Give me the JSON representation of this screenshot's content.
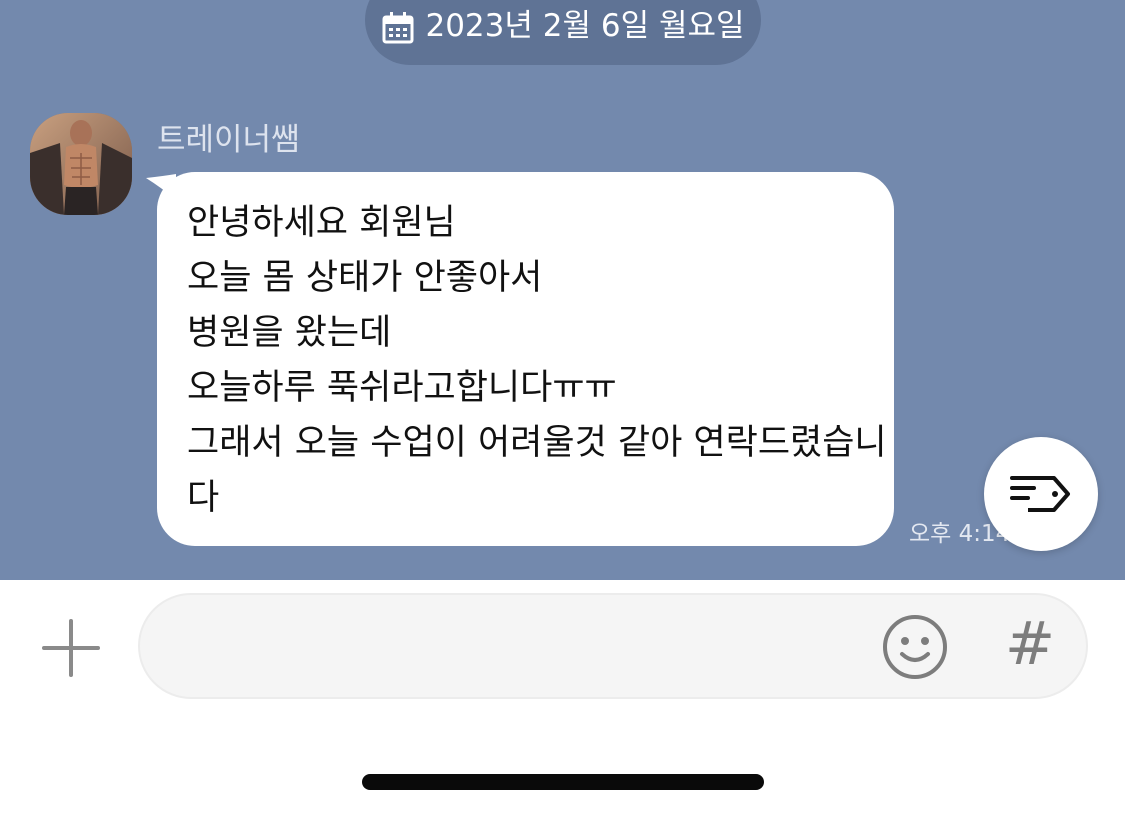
{
  "date_header": {
    "text": "2023년 2월 6일 월요일",
    "icon": "calendar-icon"
  },
  "message": {
    "sender_name": "트레이너쌤",
    "avatar": "profile-photo",
    "lines": [
      "안녕하세요 회원님",
      "오늘 몸 상태가 안좋아서",
      "병원을 왔는데",
      "오늘하루 푹쉬라고합니다ㅠㅠ",
      "그래서 오늘 수업이 어려울것 같아 연락드렸습니",
      "다"
    ],
    "time": "오후 4:14"
  },
  "floating_button": {
    "icon": "tag-list-icon"
  },
  "composer": {
    "placeholder": "",
    "value": "",
    "plus_icon": "plus-icon",
    "emoji_icon": "emoji-icon",
    "hash_label": "#"
  },
  "colors": {
    "chat_background": "#7389ad",
    "date_pill": "#5f7395",
    "bubble": "#ffffff",
    "composer_background": "#f5f5f5"
  }
}
